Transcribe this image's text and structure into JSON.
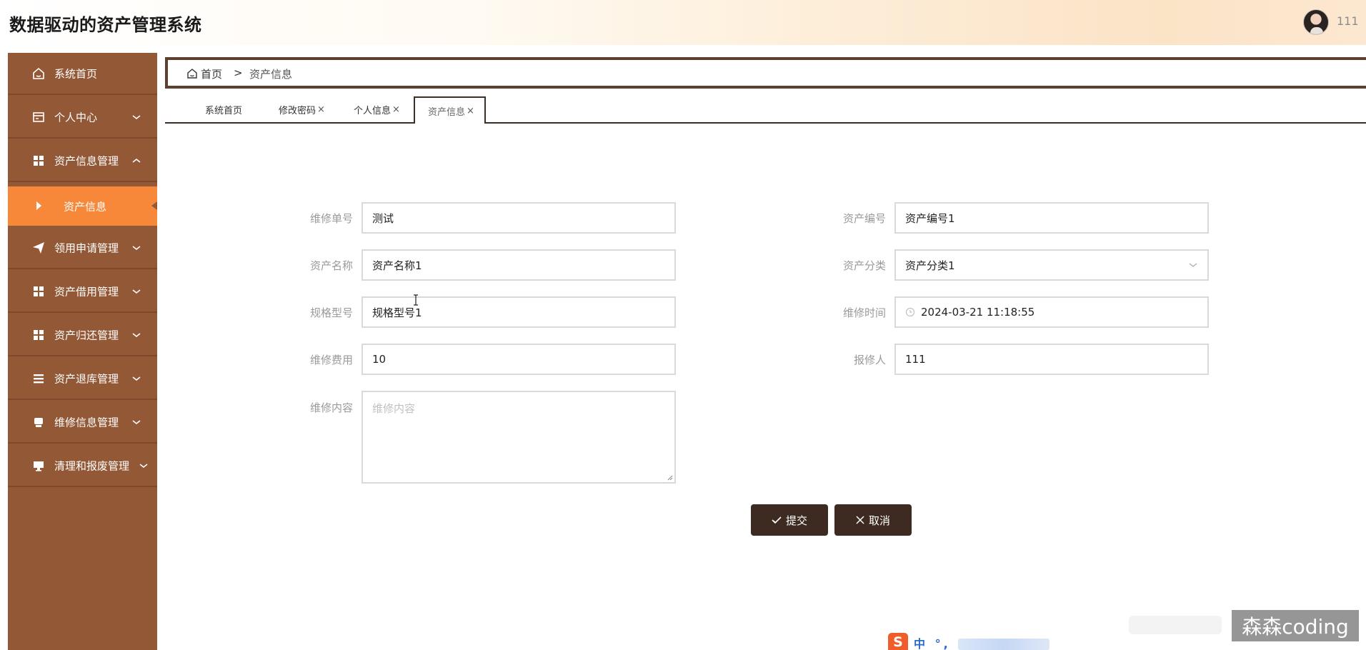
{
  "header": {
    "title": "数据驱动的资产管理系统",
    "username": "111"
  },
  "sidebar": {
    "items": [
      {
        "label": "系统首页",
        "icon": "home-icon"
      },
      {
        "label": "个人中心",
        "icon": "card-icon"
      },
      {
        "label": "资产信息管理",
        "icon": "grid-icon",
        "expanded": true
      },
      {
        "label": "领用申请管理",
        "icon": "send-icon"
      },
      {
        "label": "资产借用管理",
        "icon": "grid-icon"
      },
      {
        "label": "资产归还管理",
        "icon": "grid-icon"
      },
      {
        "label": "资产退库管理",
        "icon": "list-icon"
      },
      {
        "label": "维修信息管理",
        "icon": "tool-icon"
      },
      {
        "label": "清理和报废管理",
        "icon": "monitor-icon"
      }
    ],
    "active_sub": {
      "label": "资产信息"
    }
  },
  "breadcrumb": {
    "home": "首页",
    "separator": ">",
    "current": "资产信息"
  },
  "tabs": [
    {
      "label": "系统首页",
      "closable": false
    },
    {
      "label": "修改密码",
      "closable": true
    },
    {
      "label": "个人信息",
      "closable": true
    },
    {
      "label": "资产信息",
      "closable": true,
      "active": true
    }
  ],
  "tab_close_glyph": "×",
  "form": {
    "left": [
      {
        "label": "维修单号",
        "value": "测试"
      },
      {
        "label": "资产名称",
        "value": "资产名称1"
      },
      {
        "label": "规格型号",
        "value": "规格型号1"
      },
      {
        "label": "维修费用",
        "value": "10"
      }
    ],
    "right": [
      {
        "label": "资产编号",
        "value": "资产编号1"
      },
      {
        "label": "资产分类",
        "value": "资产分类1"
      },
      {
        "label": "维修时间",
        "value": "2024-03-21 11:18:55"
      },
      {
        "label": "报修人",
        "value": "111"
      }
    ],
    "content": {
      "label": "维修内容",
      "placeholder": "维修内容",
      "value": ""
    }
  },
  "buttons": {
    "submit": "提交",
    "cancel": "取消"
  },
  "ime": {
    "logo": "S",
    "text": "中 °,"
  },
  "watermark": "森森coding",
  "colors": {
    "sidebar": "#935836",
    "sidebar_active": "#f7883a",
    "button": "#3d2b22",
    "breadcrumb_border": "#5c3f2e"
  }
}
